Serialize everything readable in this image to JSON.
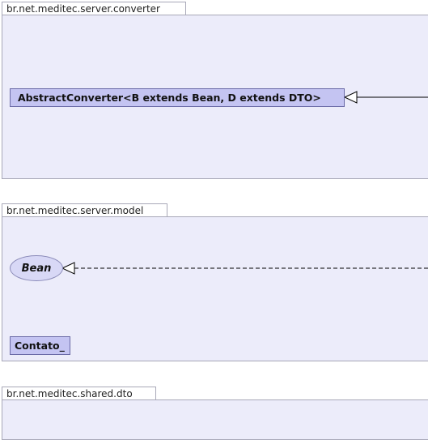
{
  "packages": [
    {
      "name": "br.net.meditec.server.converter"
    },
    {
      "name": "br.net.meditec.server.model"
    },
    {
      "name": "br.net.meditec.shared.dto"
    }
  ],
  "classes": {
    "abstract_converter": "AbstractConverter<B extends Bean, D extends DTO>",
    "bean": "Bean",
    "contato": "Contato_"
  },
  "relations": [
    {
      "type": "generalization",
      "target": "AbstractConverter<B extends Bean, D extends DTO>",
      "line": "solid"
    },
    {
      "type": "realization",
      "target": "Bean",
      "line": "dashed"
    }
  ],
  "colors": {
    "package_fill": "#ececfa",
    "class_fill": "#c4c4f2",
    "interface_fill": "#d8d8f6",
    "border": "#a8a8b8"
  }
}
